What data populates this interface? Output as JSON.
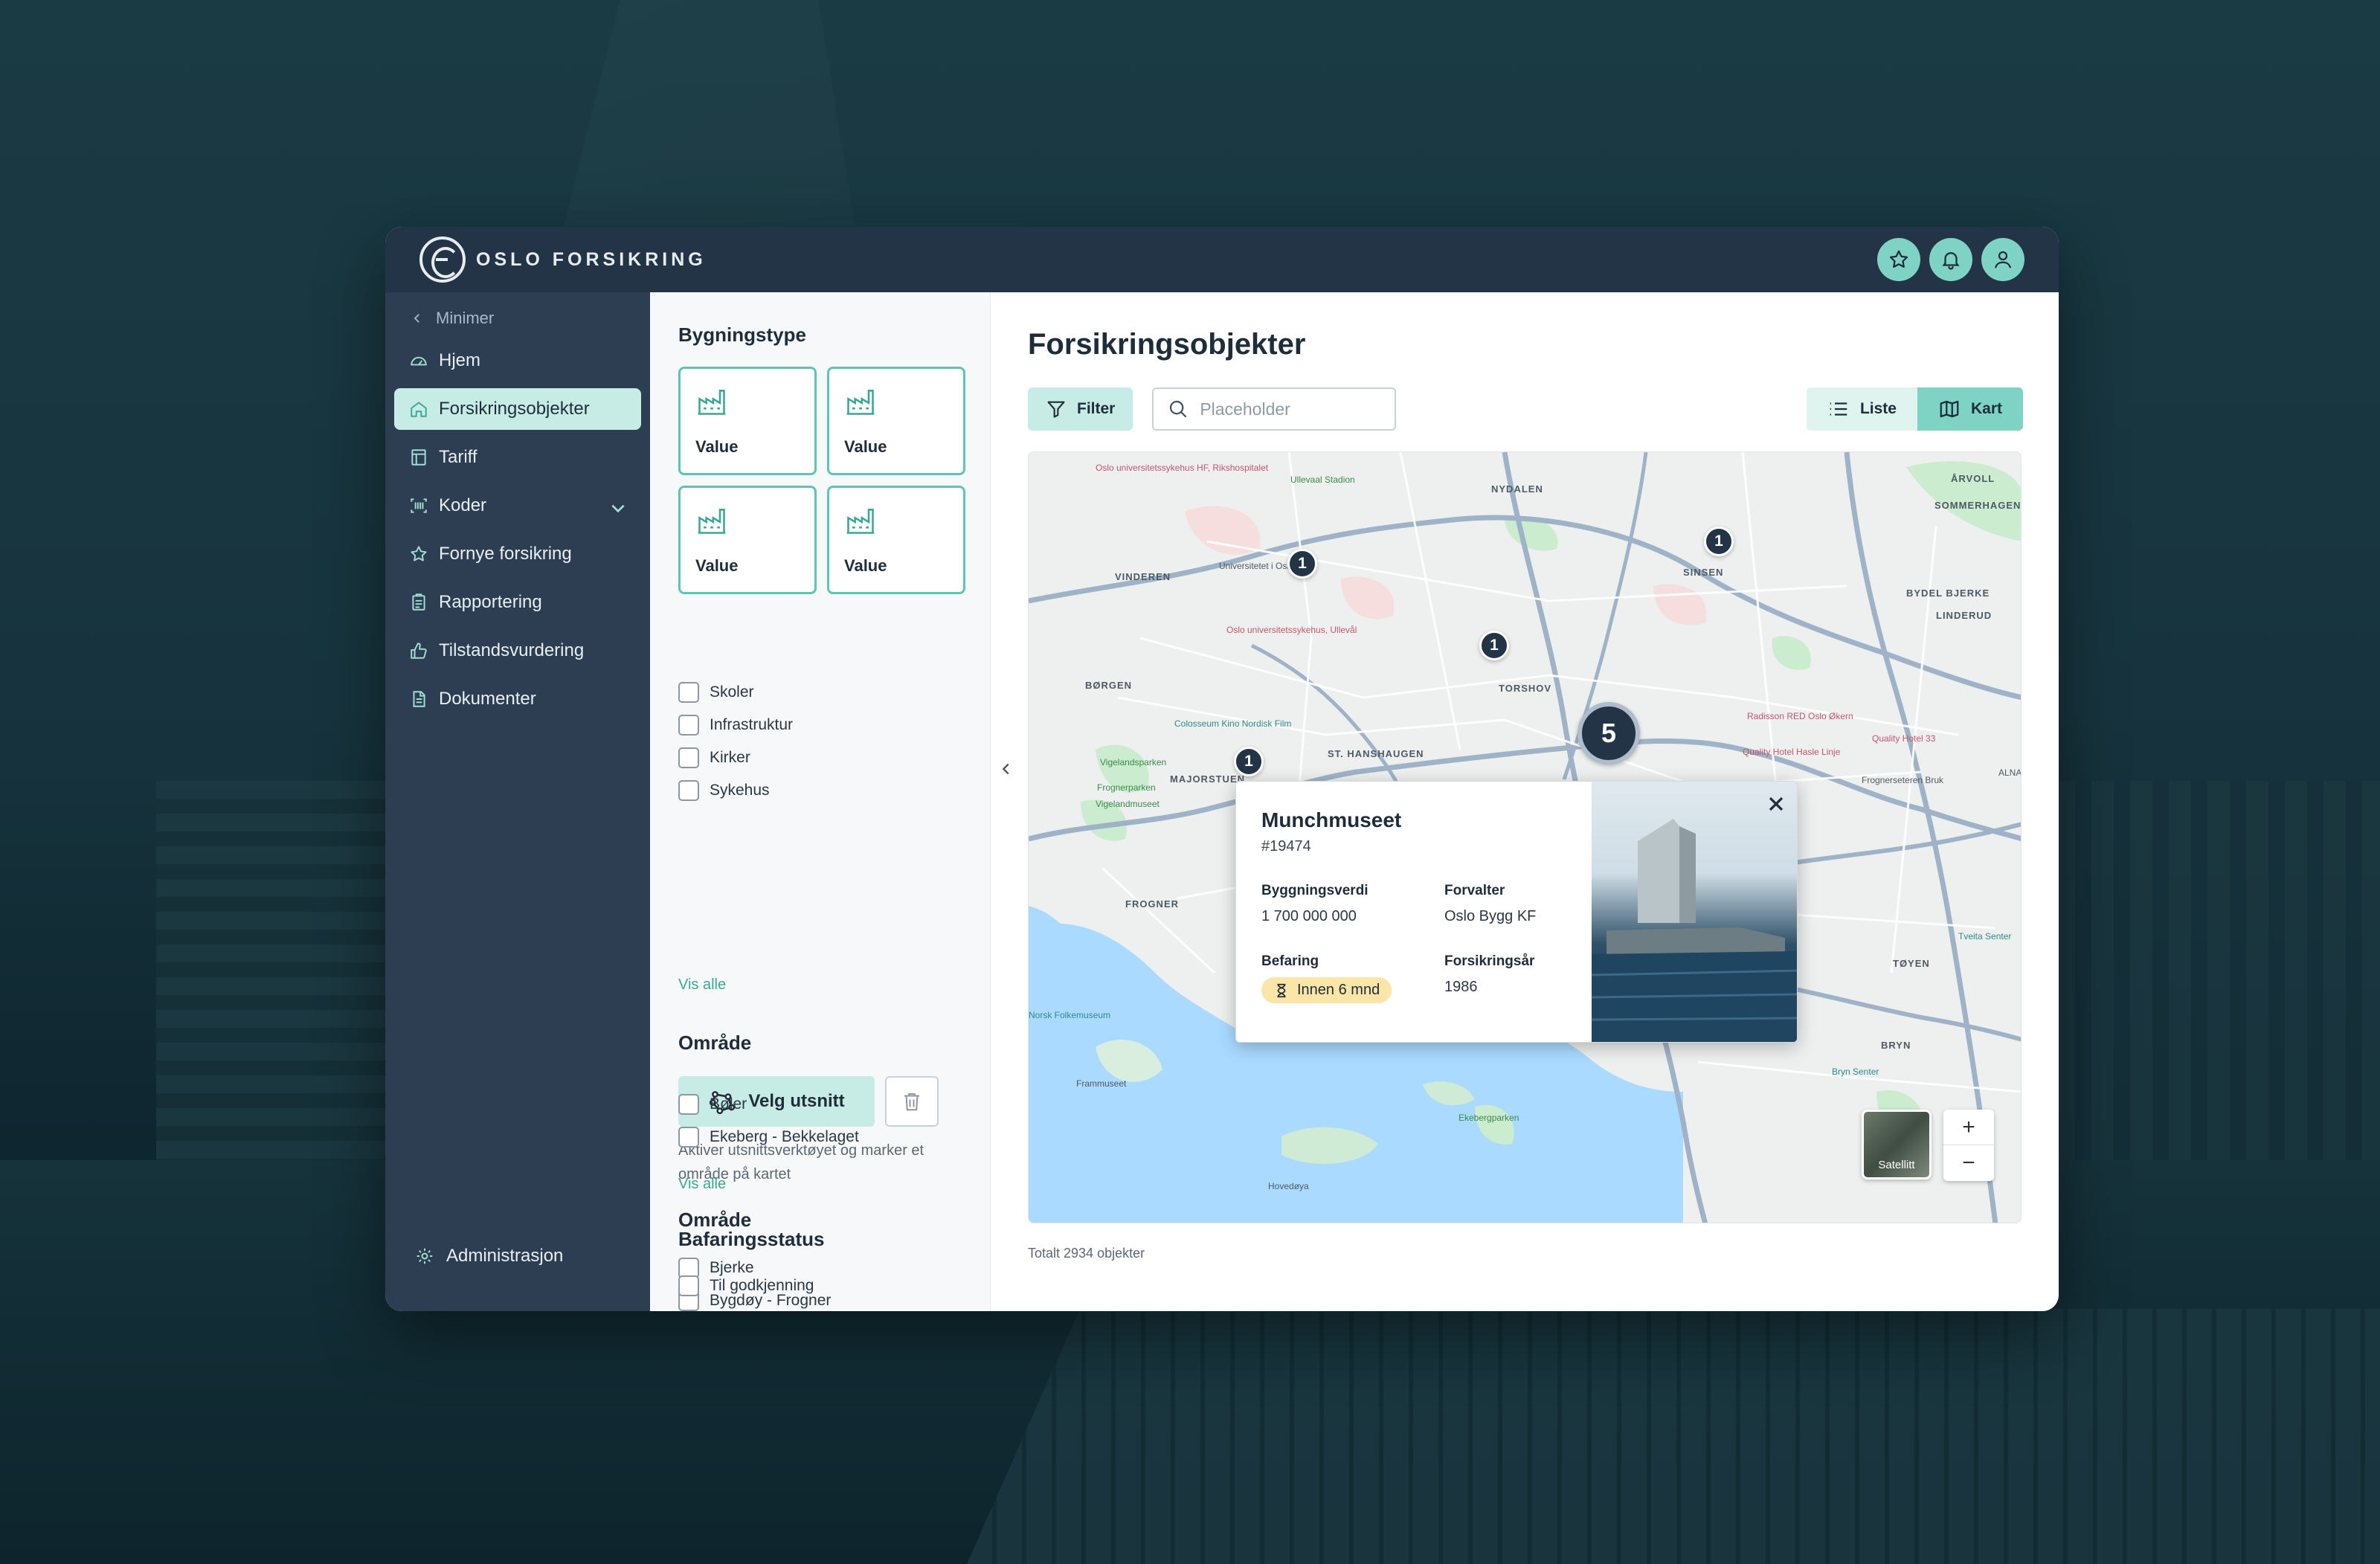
{
  "app": {
    "brand": "OSLO FORSIKRING",
    "accent": "#7fd3c4",
    "topbar_color": "#243447",
    "topbar_actions": [
      "star-icon",
      "bell-icon",
      "user-icon"
    ]
  },
  "sidebar": {
    "minimize_label": "Minimer",
    "items": [
      {
        "label": "Hjem",
        "icon": "gauge-icon"
      },
      {
        "label": "Forsikringsobjekter",
        "icon": "home-icon",
        "active": true
      },
      {
        "label": "Tariff",
        "icon": "table-icon"
      },
      {
        "label": "Koder",
        "icon": "barcode-icon"
      },
      {
        "label": "Fornye forsikring",
        "icon": "star-icon"
      },
      {
        "label": "Rapportering",
        "icon": "clipboard-icon"
      },
      {
        "label": "Tilstandsvurdering",
        "icon": "thumbs-up-icon"
      },
      {
        "label": "Dokumenter",
        "icon": "document-icon"
      }
    ],
    "admin_label": "Administrasjon"
  },
  "filters": {
    "building_type": {
      "heading": "Bygningstype",
      "cards": [
        "Value",
        "Value",
        "Value",
        "Value"
      ],
      "options": [
        "Skoler",
        "Infrastruktur",
        "Kirker",
        "Sykehus"
      ],
      "show_all": "Vis alle"
    },
    "area_select": {
      "heading": "Område",
      "button_label": "Velg utsnitt",
      "help_text": "Aktiver utsnittsverktøyet og marker et område på kartet"
    },
    "area_list": {
      "heading": "Område",
      "options": [
        "Bjerke",
        "Bygdøy - Frogner",
        "Bøler",
        "Ekeberg - Bekkelaget"
      ],
      "show_all": "Vis alle"
    },
    "inspection_status": {
      "heading": "Bafaringsstatus",
      "options": [
        "Til godkjenning"
      ]
    }
  },
  "main": {
    "title": "Forsikringsobjekter",
    "filter_button": "Filter",
    "search_placeholder": "Placeholder",
    "view_toggle": {
      "list": "Liste",
      "map": "Kart",
      "selected": "Kart"
    },
    "total_text": "Totalt 2934 objekter"
  },
  "map": {
    "district_labels": [
      "NYDALEN",
      "ÅRVOLL",
      "SINSEN",
      "VINDEREN",
      "BYDEL BJERKE",
      "TORSHOV",
      "BØRGEN",
      "ST. HANSHAUGEN",
      "MAJORSTUEN",
      "FROGNER",
      "TØYEN",
      "BRYN",
      "SOMMERHAGEN",
      "LINDERUD"
    ],
    "poi_labels": [
      "Oslo universitetssykehus HF, Rikshospitalet",
      "Ullevaal Stadion",
      "Universitetet i Oslo",
      "Oslo universitetssykehus, Ullevål",
      "Colosseum Kino Nordisk Film",
      "Vigelandsparken",
      "Frognerparken",
      "Vigelandmuseet",
      "Radisson RED Oslo Økern",
      "Quality Hotel Hasle Linje",
      "Quality Hotel 33",
      "Norsk Folkemuseum",
      "Frammuseet",
      "Ekebergparken",
      "Hovedøya",
      "Tveita Senter",
      "Bryn Senter",
      "Frognerseteren Bruk",
      "ALNA"
    ],
    "clusters": [
      1,
      1,
      1,
      1,
      1,
      5
    ],
    "satellite_label": "Satellitt",
    "zoom_in": "+",
    "zoom_out": "−"
  },
  "popup": {
    "name": "Munchmuseet",
    "id": "#19474",
    "fields": {
      "value_label": "Byggningsverdi",
      "value": "1 700 000 000",
      "manager_label": "Forvalter",
      "manager": "Oslo Bygg KF",
      "inspection_label": "Befaring",
      "inspection": "Innen 6 mnd",
      "year_label": "Forsikringsår",
      "year": "1986"
    }
  }
}
